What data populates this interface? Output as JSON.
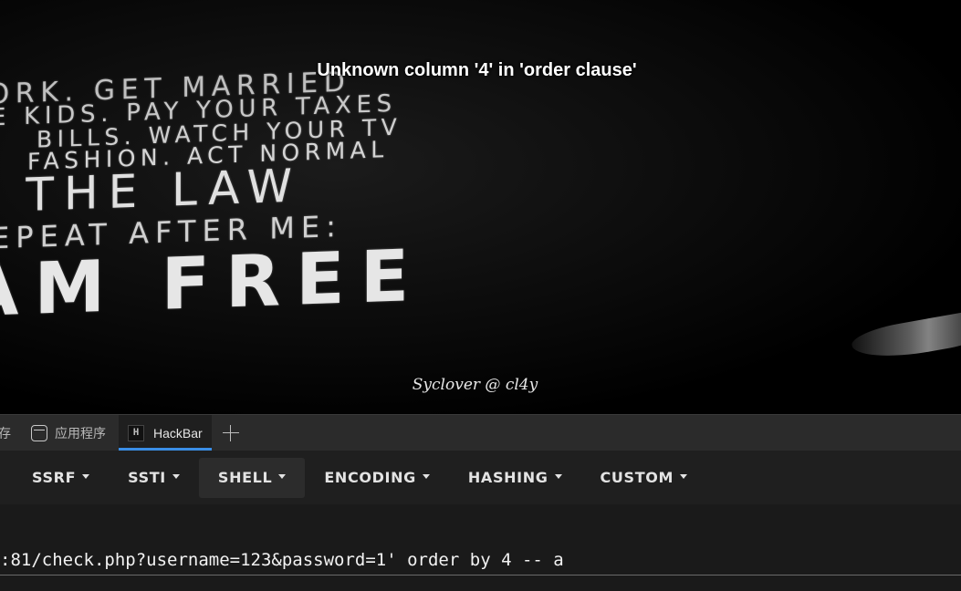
{
  "page": {
    "error_message": "Unknown column '4' in 'order clause'",
    "credit": "Syclover @ cl4y",
    "backdrop_lines": [
      "VORK. GET MARRIED",
      "E KIDS. PAY YOUR TAXES",
      "BILLS. WATCH YOUR TV",
      "FASHION. ACT NORMAL",
      "Y THE LAW",
      "EPEAT AFTER ME:",
      "AM FREE"
    ]
  },
  "devtools": {
    "tabs": [
      {
        "label": "存",
        "icon": ""
      },
      {
        "label": "应用程序",
        "icon": "app-window-icon"
      },
      {
        "label": "HackBar",
        "icon": "hackbar-icon",
        "active": true
      }
    ],
    "hackbar_icon_glyph": "H",
    "new_tab_icon": "plus-icon"
  },
  "hackbar": {
    "menus": [
      "SSRF",
      "SSTI",
      "SHELL",
      "ENCODING",
      "HASHING",
      "CUSTOM"
    ],
    "url_value": ":81/check.php?username=123&password=1' order by 4 -- a"
  },
  "colors": {
    "active_tab_underline": "#3a8ee6",
    "toolbar_bg": "#1f1f1f",
    "page_bg": "#000000"
  }
}
